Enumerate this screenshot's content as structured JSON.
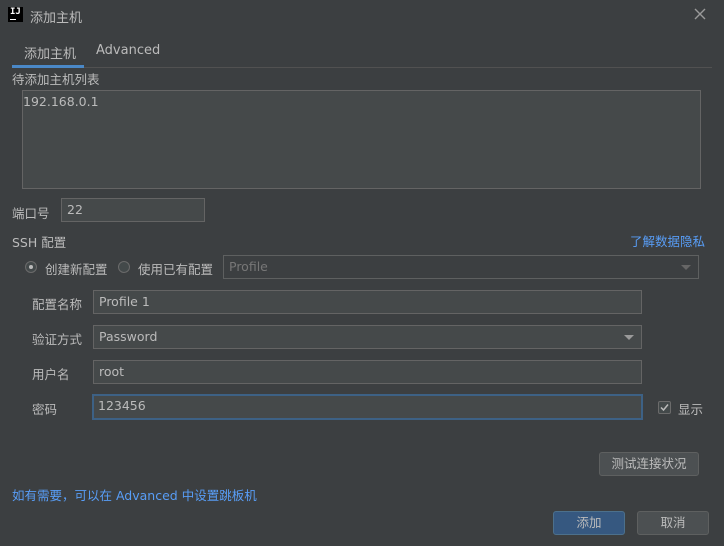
{
  "window": {
    "logo_text": "IJ",
    "title": "添加主机"
  },
  "tabs": [
    {
      "label": "添加主机",
      "active": true
    },
    {
      "label": "Advanced",
      "active": false
    }
  ],
  "hosts": {
    "label": "待添加主机列表",
    "value": "192.168.0.1"
  },
  "port": {
    "label": "端口号",
    "value": "22"
  },
  "ssh": {
    "label": "SSH 配置",
    "privacy_link": "了解数据隐私",
    "option_new": "创建新配置",
    "option_existing": "使用已有配置",
    "existing_select": "Profile",
    "selected_option": "创建新配置",
    "fields": {
      "name_label": "配置名称",
      "name_value": "Profile 1",
      "auth_label": "验证方式",
      "auth_value": "Password",
      "user_label": "用户名",
      "user_value": "root",
      "password_label": "密码",
      "password_value": "123456",
      "show_label": "显示",
      "show_checked": true
    }
  },
  "test_button": "测试连接状况",
  "hint": "如有需要，可以在 Advanced 中设置跳板机",
  "footer": {
    "ok": "添加",
    "cancel": "取消"
  },
  "colors": {
    "background": "#3c3f41",
    "accent": "#4a88c7",
    "link": "#589df6",
    "primary_button": "#365880"
  },
  "icons": {
    "close": "close-icon",
    "check": "check-icon",
    "dropdown": "chevron-down-icon"
  }
}
